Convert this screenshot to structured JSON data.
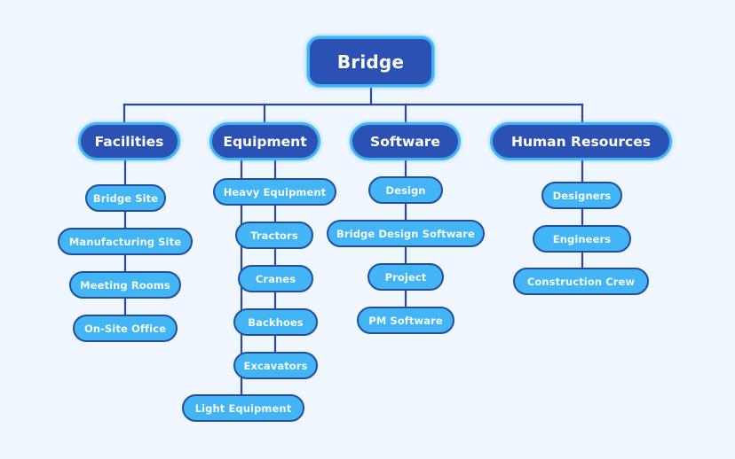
{
  "diagram": {
    "type": "hierarchy",
    "colors": {
      "background": "#eff6fe",
      "root_fill": "#2a51b3",
      "category_fill": "#2a51b3",
      "category_border": "#41b2f2",
      "leaf_fill": "#43b4f4",
      "leaf_border": "#254e9e",
      "connector": "#2a4a9a",
      "text": "#ffffff"
    },
    "root": {
      "label": "Bridge"
    },
    "categories": [
      {
        "label": "Facilities",
        "children": [
          {
            "label": "Bridge Site"
          },
          {
            "label": "Manufacturing Site"
          },
          {
            "label": "Meeting Rooms"
          },
          {
            "label": "On-Site Office"
          }
        ]
      },
      {
        "label": "Equipment",
        "children": [
          {
            "label": "Heavy Equipment",
            "children": [
              {
                "label": "Tractors"
              },
              {
                "label": "Cranes"
              },
              {
                "label": "Backhoes"
              },
              {
                "label": "Excavators"
              }
            ]
          },
          {
            "label": "Light Equipment"
          }
        ]
      },
      {
        "label": "Software",
        "children": [
          {
            "label": "Design",
            "children": [
              {
                "label": "Bridge Design Software"
              }
            ]
          },
          {
            "label": "Project",
            "children": [
              {
                "label": "PM Software"
              }
            ]
          }
        ]
      },
      {
        "label": "Human Resources",
        "children": [
          {
            "label": "Designers"
          },
          {
            "label": "Engineers"
          },
          {
            "label": "Construction Crew"
          }
        ]
      }
    ]
  }
}
